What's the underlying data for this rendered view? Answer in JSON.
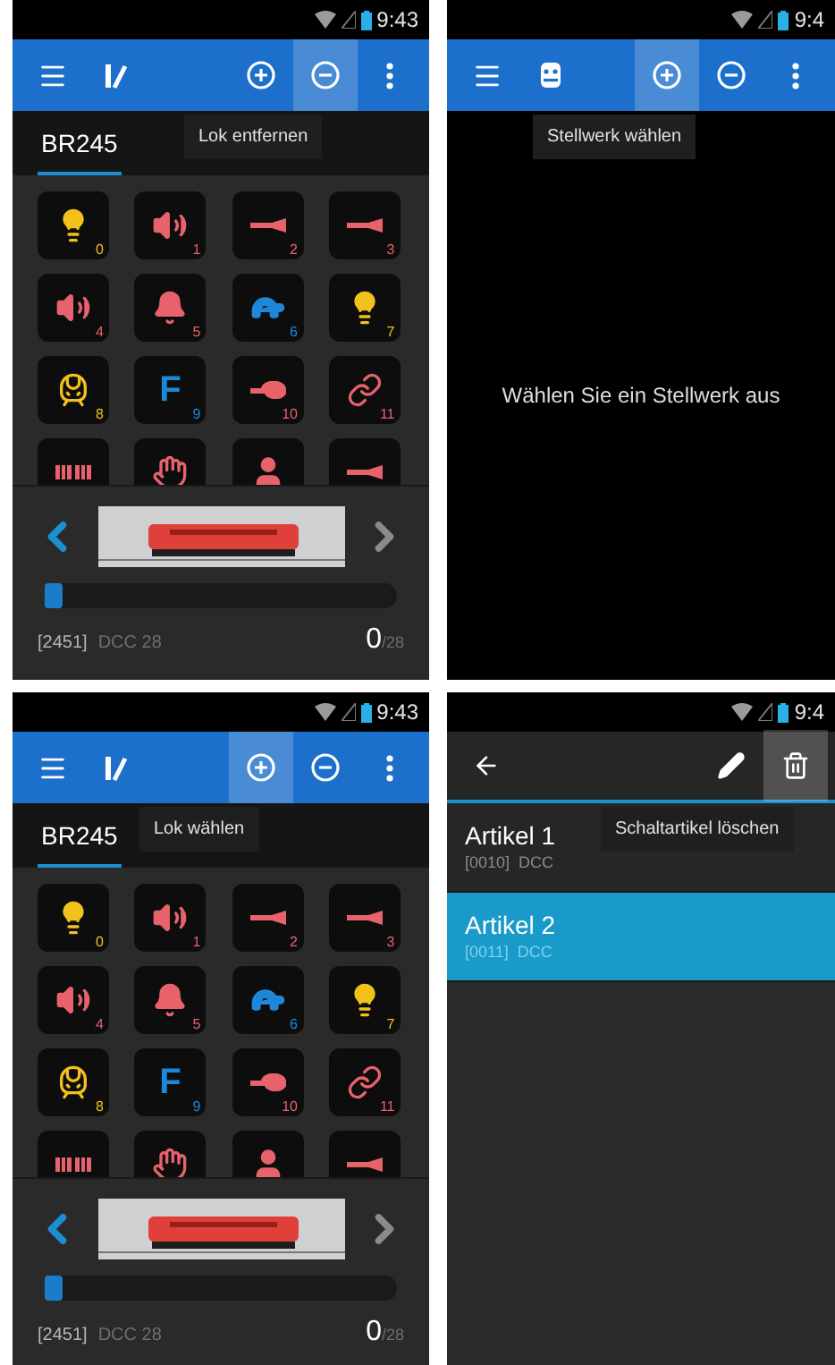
{
  "screens": [
    {
      "kind": "throttle",
      "time": "9:43",
      "toolbar": [
        {
          "kind": "menu",
          "highlighted": false
        },
        {
          "kind": "logo",
          "highlighted": false
        },
        {
          "kind": "add",
          "highlighted": false
        },
        {
          "kind": "remove",
          "highlighted": true
        },
        {
          "kind": "more",
          "highlighted": false
        }
      ],
      "tooltip": "Lok entfernen",
      "tabs": [
        {
          "label": "BR245",
          "selected": true
        }
      ],
      "functions": [
        {
          "kind": "bulb",
          "number": "0",
          "color": "#f2c21b"
        },
        {
          "kind": "speaker",
          "number": "1",
          "color": "#e8626c"
        },
        {
          "kind": "horn",
          "number": "2",
          "color": "#e8626c"
        },
        {
          "kind": "horn",
          "number": "3",
          "color": "#e8626c"
        },
        {
          "kind": "speaker",
          "number": "4",
          "color": "#e8626c"
        },
        {
          "kind": "bell",
          "number": "5",
          "color": "#e8626c"
        },
        {
          "kind": "turtle",
          "number": "6",
          "color": "#1e88d8"
        },
        {
          "kind": "bulb",
          "number": "7",
          "color": "#f2c21b"
        },
        {
          "kind": "cab",
          "number": "8",
          "color": "#f2c21b"
        },
        {
          "kind": "letter",
          "letter": "F",
          "number": "9",
          "color": "#1e88d8"
        },
        {
          "kind": "whistle",
          "number": "10",
          "color": "#e8626c"
        },
        {
          "kind": "link",
          "number": "11",
          "color": "#e8626c"
        },
        {
          "kind": "grid",
          "color": "#e8626c"
        },
        {
          "kind": "hand",
          "color": "#e8626c"
        },
        {
          "kind": "person",
          "color": "#e8626c"
        },
        {
          "kind": "horn",
          "color": "#e8626c"
        }
      ],
      "speed": {
        "level": 0
      },
      "address": "[2451]",
      "protocol": "DCC 28",
      "speed_value": "0",
      "speed_max": "/28"
    },
    {
      "kind": "empty",
      "time": "9:4",
      "toolbar": [
        {
          "kind": "menu",
          "highlighted": false
        },
        {
          "kind": "signalbox",
          "highlighted": false
        },
        {
          "kind": "add",
          "highlighted": true
        },
        {
          "kind": "remove",
          "highlighted": false
        },
        {
          "kind": "more",
          "highlighted": false
        }
      ],
      "tooltip": "Stellwerk wählen",
      "message": "Wählen Sie ein Stellwerk aus"
    },
    {
      "kind": "throttle",
      "time": "9:43",
      "toolbar": [
        {
          "kind": "menu",
          "highlighted": false
        },
        {
          "kind": "logo",
          "highlighted": false
        },
        {
          "kind": "add",
          "highlighted": true
        },
        {
          "kind": "remove",
          "highlighted": false
        },
        {
          "kind": "more",
          "highlighted": false
        }
      ],
      "tooltip": "Lok wählen",
      "tabs": [
        {
          "label": "BR245",
          "selected": true
        }
      ],
      "functions": [
        {
          "kind": "bulb",
          "number": "0",
          "color": "#f2c21b"
        },
        {
          "kind": "speaker",
          "number": "1",
          "color": "#e8626c"
        },
        {
          "kind": "horn",
          "number": "2",
          "color": "#e8626c"
        },
        {
          "kind": "horn",
          "number": "3",
          "color": "#e8626c"
        },
        {
          "kind": "speaker",
          "number": "4",
          "color": "#e8626c"
        },
        {
          "kind": "bell",
          "number": "5",
          "color": "#e8626c"
        },
        {
          "kind": "turtle",
          "number": "6",
          "color": "#1e88d8"
        },
        {
          "kind": "bulb",
          "number": "7",
          "color": "#f2c21b"
        },
        {
          "kind": "cab",
          "number": "8",
          "color": "#f2c21b"
        },
        {
          "kind": "letter",
          "letter": "F",
          "number": "9",
          "color": "#1e88d8"
        },
        {
          "kind": "whistle",
          "number": "10",
          "color": "#e8626c"
        },
        {
          "kind": "link",
          "number": "11",
          "color": "#e8626c"
        },
        {
          "kind": "grid",
          "color": "#e8626c"
        },
        {
          "kind": "hand",
          "color": "#e8626c"
        },
        {
          "kind": "person",
          "color": "#e8626c"
        },
        {
          "kind": "horn",
          "color": "#e8626c"
        }
      ],
      "speed": {
        "level": 0
      },
      "address": "[2451]",
      "protocol": "DCC 28",
      "speed_value": "0",
      "speed_max": "/28"
    },
    {
      "kind": "list",
      "time": "9:4",
      "toolbar": [
        {
          "kind": "back",
          "highlighted": false
        },
        {
          "kind": "edit",
          "highlighted": false
        },
        {
          "kind": "delete",
          "highlighted": true
        }
      ],
      "tooltip": "Schaltartikel löschen",
      "items": [
        {
          "name": "Artikel 1",
          "detail": "[0010]  DCC",
          "selected": false
        },
        {
          "name": "Artikel 2",
          "detail": "[0011]  DCC",
          "selected": true
        }
      ]
    }
  ]
}
